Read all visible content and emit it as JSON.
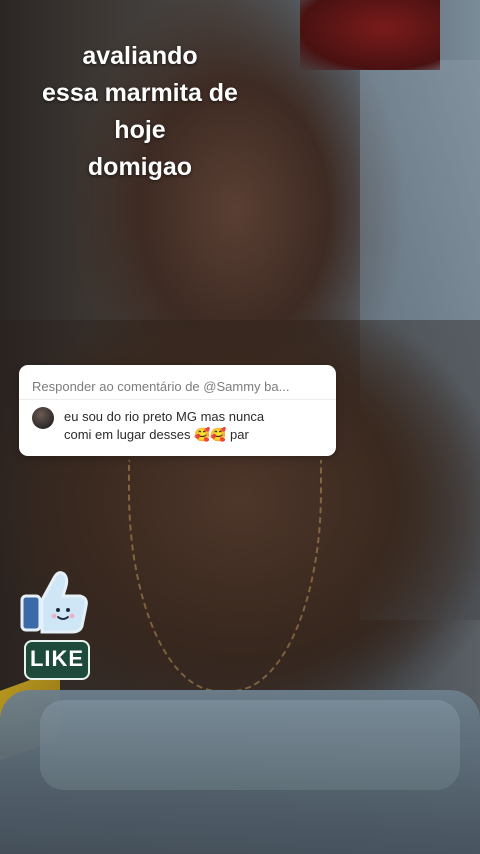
{
  "caption": {
    "lines": [
      "avaliando",
      "essa marmita de",
      "hoje",
      "domigao"
    ]
  },
  "reply_card": {
    "header": "Responder ao comentário de @Sammy ba...",
    "comment_line1": "eu sou do rio preto MG mas nunca",
    "comment_line2": "comi em lugar desses 🥰🥰 par"
  },
  "sticker": {
    "icon": "thumbs-up-icon",
    "label": "LIKE"
  }
}
